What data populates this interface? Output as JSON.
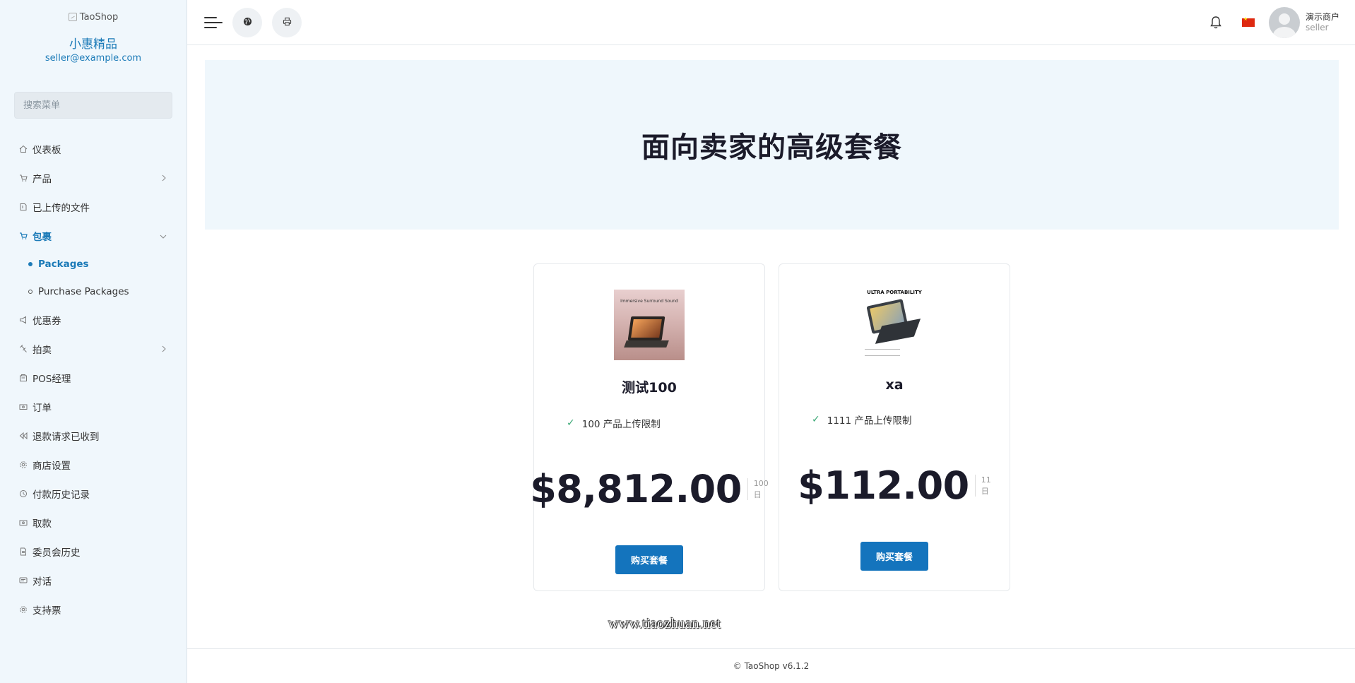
{
  "sidebar": {
    "logo_alt": "TaoShop",
    "shop_name": "小惠精品",
    "email": "seller@example.com",
    "search_placeholder": "搜索菜单",
    "items": [
      {
        "label": "仪表板",
        "icon": "home-icon"
      },
      {
        "label": "产品",
        "icon": "cart-icon",
        "has_children": true
      },
      {
        "label": "已上传的文件",
        "icon": "folder-icon"
      },
      {
        "label": "包裹",
        "icon": "cart-icon",
        "expanded": true,
        "active": true
      },
      {
        "label": "优惠券",
        "icon": "megaphone-icon"
      },
      {
        "label": "拍卖",
        "icon": "gavel-icon",
        "has_children": true
      },
      {
        "label": "POS经理",
        "icon": "pos-icon"
      },
      {
        "label": "订单",
        "icon": "money-icon"
      },
      {
        "label": "退款请求已收到",
        "icon": "backward-icon"
      },
      {
        "label": "商店设置",
        "icon": "gear-icon"
      },
      {
        "label": "付款历史记录",
        "icon": "history-icon"
      },
      {
        "label": "取款",
        "icon": "money-icon"
      },
      {
        "label": "委员会历史",
        "icon": "file-icon"
      },
      {
        "label": "对话",
        "icon": "chat-icon"
      },
      {
        "label": "支持票",
        "icon": "support-icon"
      }
    ],
    "sub_items": [
      {
        "label": "Packages",
        "active": true
      },
      {
        "label": "Purchase Packages",
        "active": false
      }
    ]
  },
  "header": {
    "user_name": "演示商户",
    "user_role": "seller",
    "flag_color": "#de2910"
  },
  "hero": {
    "title": "面向卖家的高级套餐"
  },
  "packages": [
    {
      "name": "测试100",
      "image_caption": "Immersive Surround Sound",
      "feature": "100 产品上传限制",
      "price": "$8,812.00",
      "duration": "100",
      "unit": "日",
      "button": "购买套餐"
    },
    {
      "name": "xa",
      "image_caption": "ULTRA PORTABILITY",
      "feature": "1111 产品上传限制",
      "price": "$112.00",
      "duration": "11",
      "unit": "日",
      "button": "购买套餐"
    }
  ],
  "watermark": "www.tiaozhuan.net",
  "footer": {
    "copyright": "© TaoShop v6.1.2"
  },
  "colors": {
    "accent": "#1c7bb8",
    "button": "#1474bd",
    "check": "#3aa875"
  }
}
